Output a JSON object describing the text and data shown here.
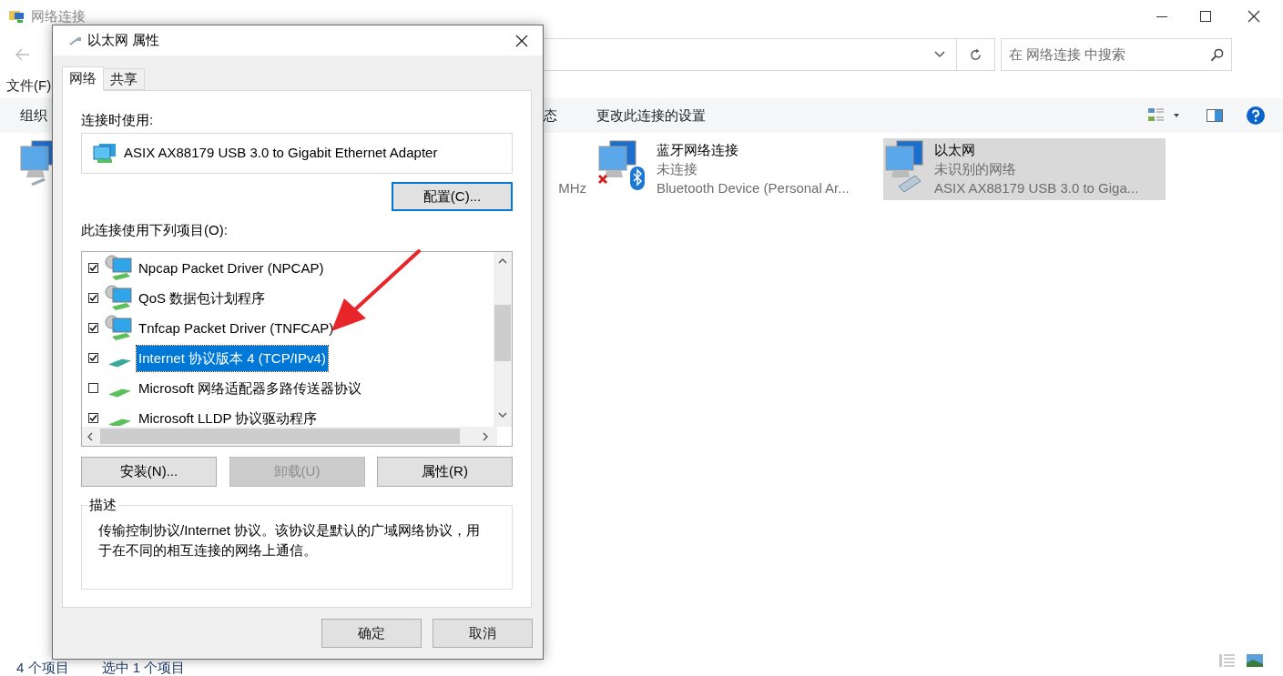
{
  "window": {
    "title": "网络连接",
    "search": {
      "placeholder": "在 网络连接 中搜索"
    },
    "menu": [
      "文件(F)"
    ],
    "toolbar": [
      {
        "label": "组织"
      },
      {
        "label": "态"
      },
      {
        "label": "更改此连接的设置"
      }
    ],
    "connections": [
      {
        "kind": "wired",
        "selected": false
      },
      {
        "kind": "wireless",
        "device": "MHz",
        "selected": false
      },
      {
        "kind": "bluetooth",
        "name": "蓝牙网络连接",
        "status": "未连接",
        "device": "Bluetooth Device (Personal Ar...",
        "selected": false
      },
      {
        "kind": "ethernet",
        "name": "以太网",
        "status": "未识别的网络",
        "device": "ASIX AX88179 USB 3.0 to Giga...",
        "selected": true
      }
    ],
    "status_bar": [
      "4 个项目",
      "选中 1 个项目"
    ]
  },
  "dialog": {
    "title": "以太网 属性",
    "tabs": [
      {
        "label": "网络",
        "selected": true
      },
      {
        "label": "共享",
        "selected": false
      }
    ],
    "connect_using_label": "连接时使用:",
    "adapter": "ASIX AX88179 USB 3.0 to Gigabit Ethernet Adapter",
    "configure_button": "配置(C)...",
    "items_label": "此连接使用下列项目(O):",
    "items": [
      {
        "kind": "service",
        "label": "Npcap Packet Driver (NPCAP)",
        "checked": true,
        "selected": false
      },
      {
        "kind": "service",
        "label": "QoS 数据包计划程序",
        "checked": true,
        "selected": false
      },
      {
        "kind": "service",
        "label": "Tnfcap Packet Driver (TNFCAP)",
        "checked": true,
        "selected": false
      },
      {
        "kind": "protocol",
        "label": "Internet 协议版本 4 (TCP/IPv4)",
        "checked": true,
        "selected": true
      },
      {
        "kind": "protocol",
        "label": "Microsoft 网络适配器多路传送器协议",
        "checked": false,
        "selected": false
      },
      {
        "kind": "protocol",
        "label": "Microsoft LLDP 协议驱动程序",
        "checked": true,
        "selected": false
      }
    ],
    "buttons": [
      {
        "label": "安装(N)...",
        "disabled": false
      },
      {
        "label": "卸载(U)",
        "disabled": true
      },
      {
        "label": "属性(R)",
        "disabled": false
      }
    ],
    "description_label": "描述",
    "description": "传输控制协议/Internet 协议。该协议是默认的广域网络协议，用于在不同的相互连接的网络上通信。",
    "ok_button": "确定",
    "cancel_button": "取消"
  }
}
